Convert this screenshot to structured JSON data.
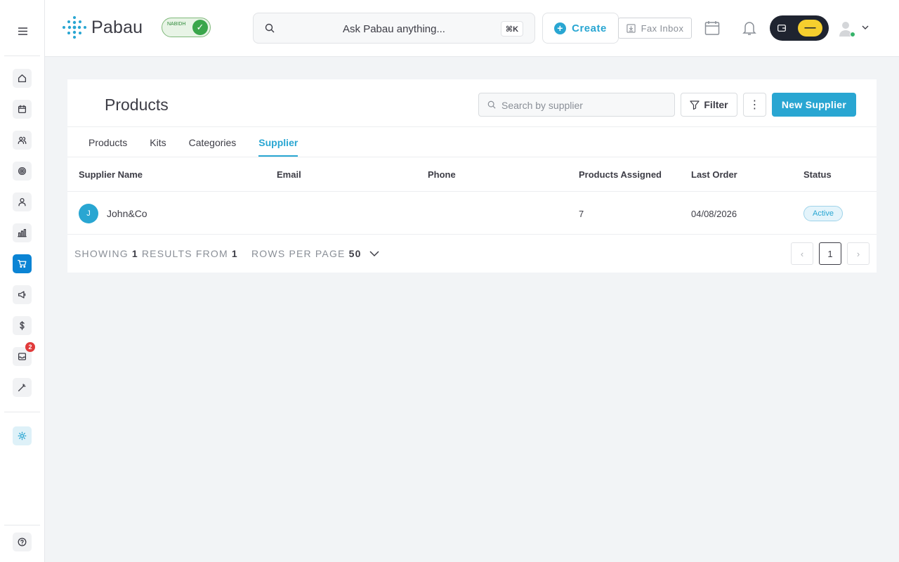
{
  "header": {
    "brand": "Pabau",
    "nabidh_badge": "NABIDH",
    "search_placeholder": "Ask Pabau anything...",
    "search_shortcut": "⌘K",
    "create_label": "Create",
    "fax_label": "Fax Inbox"
  },
  "sidebar": {
    "items": [
      {
        "icon": "home-icon"
      },
      {
        "icon": "calendar-icon"
      },
      {
        "icon": "contacts-icon"
      },
      {
        "icon": "target-icon"
      },
      {
        "icon": "user-icon"
      },
      {
        "icon": "reports-icon"
      },
      {
        "icon": "cart-icon",
        "active": true
      },
      {
        "icon": "megaphone-icon"
      },
      {
        "icon": "dollar-icon"
      },
      {
        "icon": "inbox-icon",
        "badge": "2"
      },
      {
        "icon": "magic-wand-icon"
      }
    ],
    "settings_icon": "sun-icon",
    "help_icon": "help-icon"
  },
  "page": {
    "title": "Products",
    "search_placeholder": "Search by supplier",
    "filter_label": "Filter",
    "more_label": "⋮",
    "new_button_label": "New Supplier",
    "tabs": [
      {
        "label": "Products"
      },
      {
        "label": "Kits"
      },
      {
        "label": "Categories"
      },
      {
        "label": "Supplier",
        "active": true
      }
    ]
  },
  "table": {
    "columns": [
      "Supplier Name",
      "Email",
      "Phone",
      "Products Assigned",
      "Last Order",
      "Status"
    ],
    "rows": [
      {
        "initial": "J",
        "name": "John&Co",
        "email": "",
        "phone": "",
        "products_assigned": "7",
        "last_order": "04/08/2026",
        "status": "Active"
      }
    ]
  },
  "pagination": {
    "showing_label": "SHOWING",
    "showing_count": "1",
    "results_from_label": "RESULTS FROM",
    "total": "1",
    "rows_per_page_label": "ROWS PER PAGE",
    "rows_per_page": "50",
    "current_page": "1",
    "prev": "‹",
    "next": "›"
  },
  "colors": {
    "accent": "#29a6d2",
    "active_nav": "#0b84d4",
    "badge": "#e13b3b",
    "toggle_dark": "#1f2430",
    "toggle_light": "#f6cf2e"
  }
}
